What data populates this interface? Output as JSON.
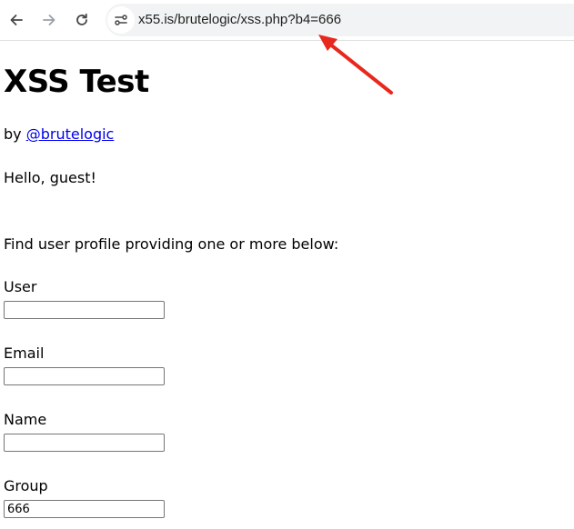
{
  "browser": {
    "url": "x55.is/brutelogic/xss.php?b4=666",
    "nav_icons": [
      "back-arrow-icon",
      "forward-arrow-icon",
      "reload-icon",
      "site-info-icon"
    ]
  },
  "annotation": {
    "arrow_color": "#e8281e"
  },
  "page": {
    "title": "XSS Test",
    "byline_prefix": "by",
    "byline_link": "@brutelogic",
    "greeting": "Hello, guest!",
    "instructions": "Find user profile providing one or more below:",
    "fields": [
      {
        "label": "User",
        "value": ""
      },
      {
        "label": "Email",
        "value": ""
      },
      {
        "label": "Name",
        "value": ""
      },
      {
        "label": "Group",
        "value": "666"
      }
    ]
  },
  "colors": {
    "link": "#0000ee",
    "omnibox_bg": "#f1f3f4"
  }
}
